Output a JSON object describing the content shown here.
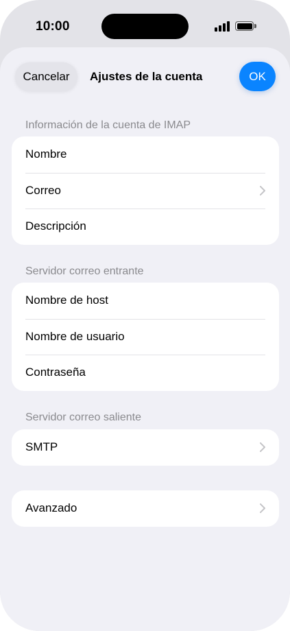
{
  "status_bar": {
    "time": "10:00",
    "icons": [
      "cellular-signal-icon",
      "battery-icon"
    ]
  },
  "nav": {
    "cancel_label": "Cancelar",
    "title": "Ajustes de la cuenta",
    "ok_label": "OK"
  },
  "sections": [
    {
      "header": "Información de la cuenta de IMAP",
      "rows": [
        {
          "label": "Nombre"
        },
        {
          "label": "Correo"
        },
        {
          "label": "Descripción"
        }
      ]
    },
    {
      "header": "Servidor correo entrante",
      "rows": [
        {
          "label": "Nombre de host"
        },
        {
          "label": "Nombre de usuario"
        },
        {
          "label": "Contraseña"
        }
      ]
    },
    {
      "header": "Servidor correo saliente",
      "rows": [
        {
          "label": "SMTP"
        }
      ]
    },
    {
      "header": "",
      "rows": [
        {
          "label": "Avanzado"
        }
      ]
    }
  ],
  "colors": {
    "accent": "#0a84ff",
    "background": "#f0f0f6",
    "secondary_text": "#8a8a8e",
    "chevron": "#c4c4c7"
  }
}
